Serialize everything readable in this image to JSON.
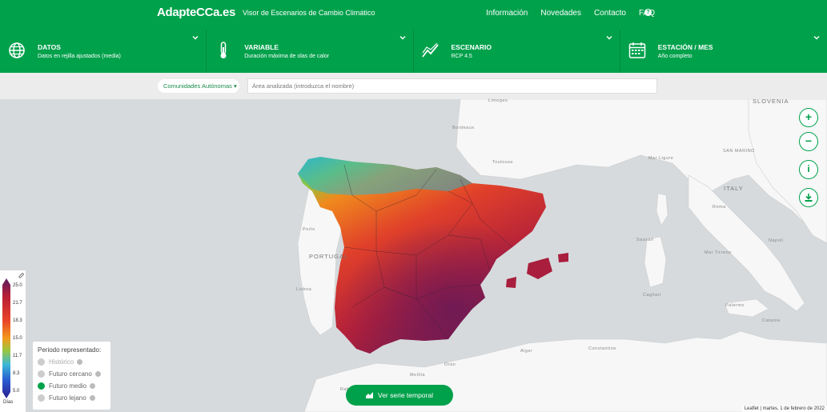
{
  "header": {
    "brand": "AdapteCCa.es",
    "subtitle": "Visor de Escenarios de Cambio Climático",
    "nav": [
      "Información",
      "Novedades",
      "Contacto",
      "FAQ"
    ],
    "help": "?"
  },
  "selectors": [
    {
      "label": "DATOS",
      "value": "Datos en rejilla ajustados (media)",
      "icon": "globe-icon"
    },
    {
      "label": "VARIABLE",
      "value": "Duración máxima de olas de calor",
      "icon": "thermometer-icon"
    },
    {
      "label": "ESCENARIO",
      "value": "RCP 4.5",
      "icon": "trend-chart-icon"
    },
    {
      "label": "ESTACIÓN / MES",
      "value": "Año completo",
      "icon": "calendar-icon"
    }
  ],
  "filter": {
    "region_select": "Comunidades Autónomas",
    "search_placeholder": "Área analizada (introduzca el nombre)"
  },
  "map_controls": {
    "zoom_in": "+",
    "zoom_out": "−",
    "info": "i",
    "download": "download-icon"
  },
  "map_labels": {
    "portugal": "PORTUGAL",
    "italy": "ITALY",
    "slovenia": "SLOVENIA",
    "san_marino": "SAN MARINO",
    "mar_liguria": "Mar Ligure",
    "mar_tirreno": "Mar Tirreno",
    "cities": [
      "Limoges",
      "Bordeaux",
      "Toulouse",
      "Roma",
      "Napoli",
      "Constantine",
      "Alger",
      "Oran",
      "Rabat",
      "Melilla",
      "Lisboa",
      "Porto",
      "Catania",
      "Palermo",
      "Cagliari",
      "Sassari"
    ]
  },
  "legend": {
    "unit": "Días",
    "ticks": [
      "25.0",
      "21.7",
      "18.3",
      "15.0",
      "11.7",
      "8.3",
      "5.0"
    ],
    "colors": [
      "#5a1b5e",
      "#b81e36",
      "#e9432a",
      "#f39a1c",
      "#9ac63e",
      "#3bb7d8",
      "#2a5bd0",
      "#2a1d8f"
    ]
  },
  "periods": {
    "title": "Periodo representado:",
    "items": [
      {
        "label": "Histórico",
        "selected": false,
        "enabled": false
      },
      {
        "label": "Futuro cercano",
        "selected": false,
        "enabled": true
      },
      {
        "label": "Futuro medio",
        "selected": true,
        "enabled": true
      },
      {
        "label": "Futuro lejano",
        "selected": false,
        "enabled": true
      }
    ]
  },
  "serie_button": "Ver serie temporal",
  "attribution": "Leaflet | martes, 1 de febrero de 2022",
  "colors": {
    "brand_green": "#00a14b"
  }
}
